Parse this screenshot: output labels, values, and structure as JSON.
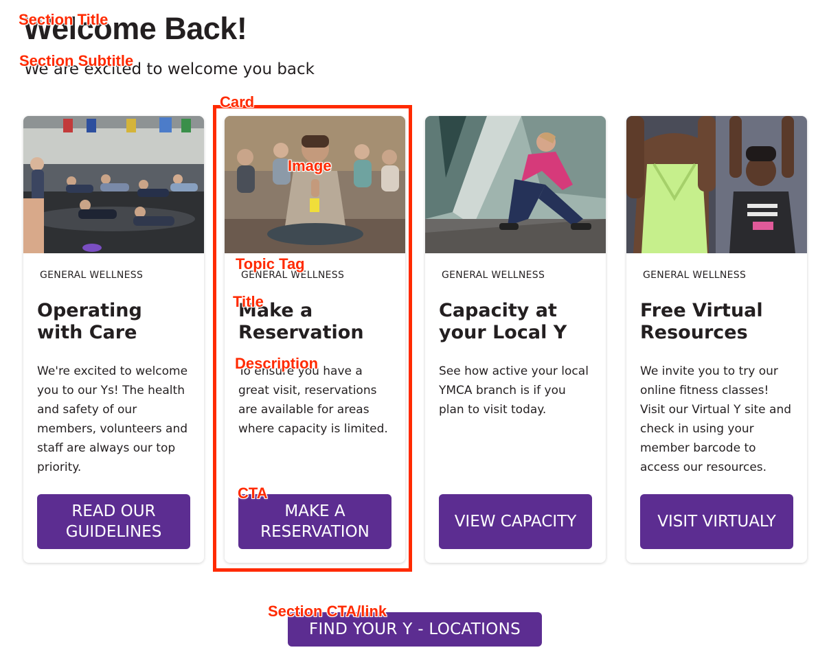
{
  "section": {
    "title": "Welcome Back!",
    "subtitle": "We are excited to welcome you back",
    "cta_label": "FIND YOUR Y - LOCATIONS"
  },
  "cards": [
    {
      "tag": "GENERAL WELLNESS",
      "title": "Operating with Care",
      "description": "We're excited to welcome you to our Ys! The health and safety of our members, volunteers and staff are always our top priority.",
      "cta_label": "READ OUR GUIDELINES"
    },
    {
      "tag": "GENERAL WELLNESS",
      "title": "Make a Reservation",
      "description": "To ensure you have a great visit, reservations are available for areas where capacity is limited.",
      "cta_label": "MAKE A RESERVATION"
    },
    {
      "tag": "GENERAL WELLNESS",
      "title": "Capacity at your Local Y",
      "description": "See how active your local YMCA branch is if you plan to visit today.",
      "cta_label": "VIEW CAPACITY"
    },
    {
      "tag": "GENERAL WELLNESS",
      "title": "Free Virtual Resources",
      "description": "We invite you to try our online fitness classes! Visit our Virtual Y site and check in using your member barcode to access our resources.",
      "cta_label": "VISIT VIRTUALY"
    }
  ],
  "annotations": {
    "section_title": "Section Title",
    "section_subtitle": "Section Subtitle",
    "card": "Card",
    "image": "Image",
    "topic_tag": "Topic Tag",
    "title": "Title",
    "description": "Description",
    "cta": "CTA",
    "section_cta": "Section CTA/link"
  },
  "colors": {
    "brand_purple": "#5c2d91",
    "annotation_red": "#ff2a00",
    "text": "#231f20"
  }
}
